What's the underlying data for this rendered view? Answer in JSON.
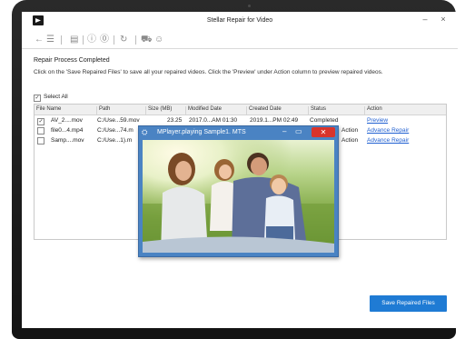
{
  "window": {
    "title": "Stellar Repair for Video",
    "minimize": "–",
    "close": "×"
  },
  "toolbar": {
    "icons": [
      "back-icon",
      "menu-icon",
      "save-icon",
      "info-icon",
      "help-icon",
      "refresh-icon",
      "cart-icon",
      "account-icon"
    ]
  },
  "main": {
    "heading": "Repair Process Completed",
    "description": "Click on the 'Save Repaired Files' to save all your repaired videos. Click the 'Preview' under Action column to preview repaired videos.",
    "select_all": "Select All"
  },
  "table": {
    "columns": [
      "File Name",
      "Path",
      "Size (MB)",
      "Modified Date",
      "Created Date",
      "Status",
      "Action"
    ],
    "rows": [
      {
        "name": "AV_2....mov",
        "path": "C:/Use...59.mov",
        "size": "23.25",
        "modified": "2017.0...AM 01:30",
        "created": "2019.1...PM 02:49",
        "status": "Completed",
        "action": "Preview",
        "checked": true
      },
      {
        "name": "file0...4.mp4",
        "path": "C:/Use...74.m",
        "size": "",
        "modified": "",
        "created": "",
        "status": "Action",
        "action": "Advance Repair",
        "checked": false
      },
      {
        "name": "Samp....mov",
        "path": "C:/Use...1).m",
        "size": "",
        "modified": "",
        "created": "",
        "status": "Action",
        "action": "Advance Repair",
        "checked": false
      }
    ]
  },
  "mplayer": {
    "title": "MPlayer.playing Sample1. MTS",
    "minimize": "–",
    "maximize": "▭",
    "close": "✕"
  },
  "save_button": "Save Repaired Files",
  "colors": {
    "accent": "#1f7bd4",
    "link": "#1f5fd1",
    "mplayer_frame": "#4a83c3",
    "close_red": "#d9342b"
  }
}
